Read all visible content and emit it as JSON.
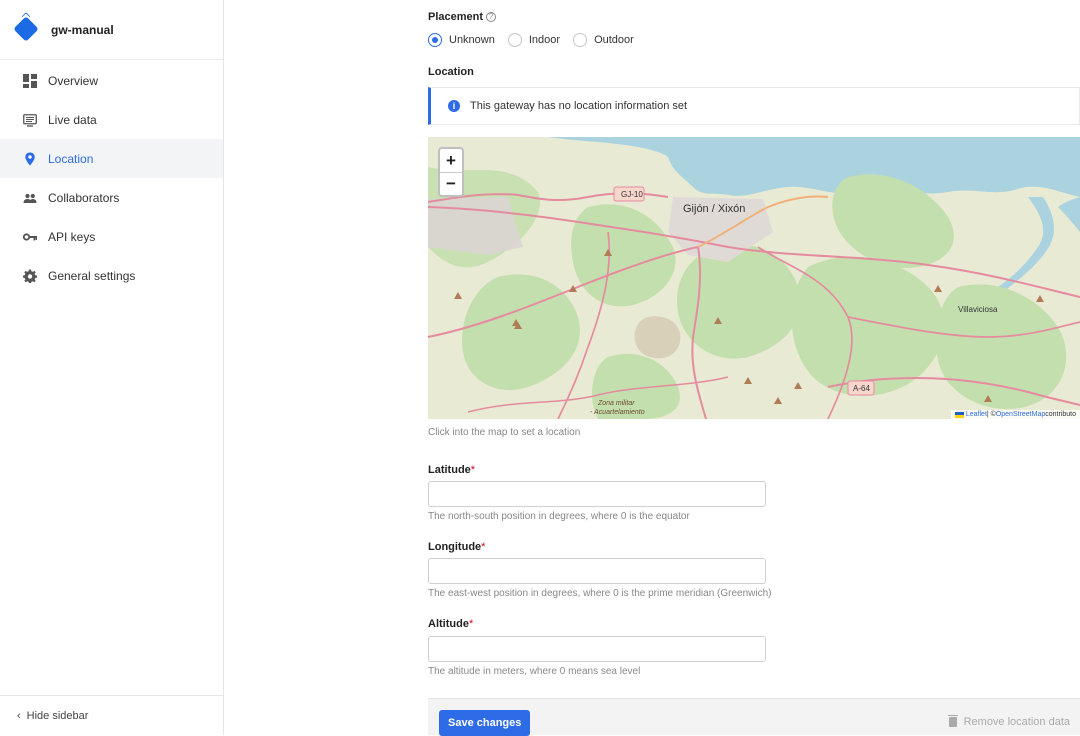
{
  "sidebar": {
    "brand": "gw-manual",
    "items": [
      {
        "label": "Overview",
        "icon": "overview-grid-icon"
      },
      {
        "label": "Live data",
        "icon": "live-data-monitor-icon"
      },
      {
        "label": "Location",
        "icon": "location-pin-icon",
        "active": true
      },
      {
        "label": "Collaborators",
        "icon": "collaborators-group-icon"
      },
      {
        "label": "API keys",
        "icon": "key-icon"
      },
      {
        "label": "General settings",
        "icon": "gear-icon"
      }
    ],
    "hide_label": "Hide sidebar"
  },
  "placement": {
    "title": "Placement",
    "options": [
      "Unknown",
      "Indoor",
      "Outdoor"
    ],
    "selected": "Unknown"
  },
  "location": {
    "title": "Location",
    "info": "This gateway has no location information set",
    "map_help": "Click into the map to set a location"
  },
  "map": {
    "zoom_in": "+",
    "zoom_out": "−",
    "attribution_leaflet": "Leaflet",
    "attribution_sep": " | © ",
    "attribution_osm": "OpenStreetMap",
    "attribution_tail": " contributo",
    "labels": {
      "city": "Gijón / Xixón",
      "town": "Villaviciosa",
      "zone1": "Zona militar",
      "zone2": "- Acuartelamiento",
      "gi10": "GJ-10",
      "a64": "A-64"
    }
  },
  "fields": {
    "latitude": {
      "label": "Latitude",
      "value": "",
      "help": "The north-south position in degrees, where 0 is the equator"
    },
    "longitude": {
      "label": "Longitude",
      "value": "",
      "help": "The east-west position in degrees, where 0 is the prime meridian (Greenwich)"
    },
    "altitude": {
      "label": "Altitude",
      "value": "",
      "help": "The altitude in meters, where 0 means sea level"
    },
    "required_mark": "*"
  },
  "footer": {
    "save": "Save changes",
    "remove": "Remove location data"
  },
  "colors": {
    "accent": "#2e6be6",
    "required": "#d0021b",
    "sea": "#aad3df",
    "land": "#e9ead3",
    "forest": "#c4dfae",
    "road": "#e58b9f"
  }
}
